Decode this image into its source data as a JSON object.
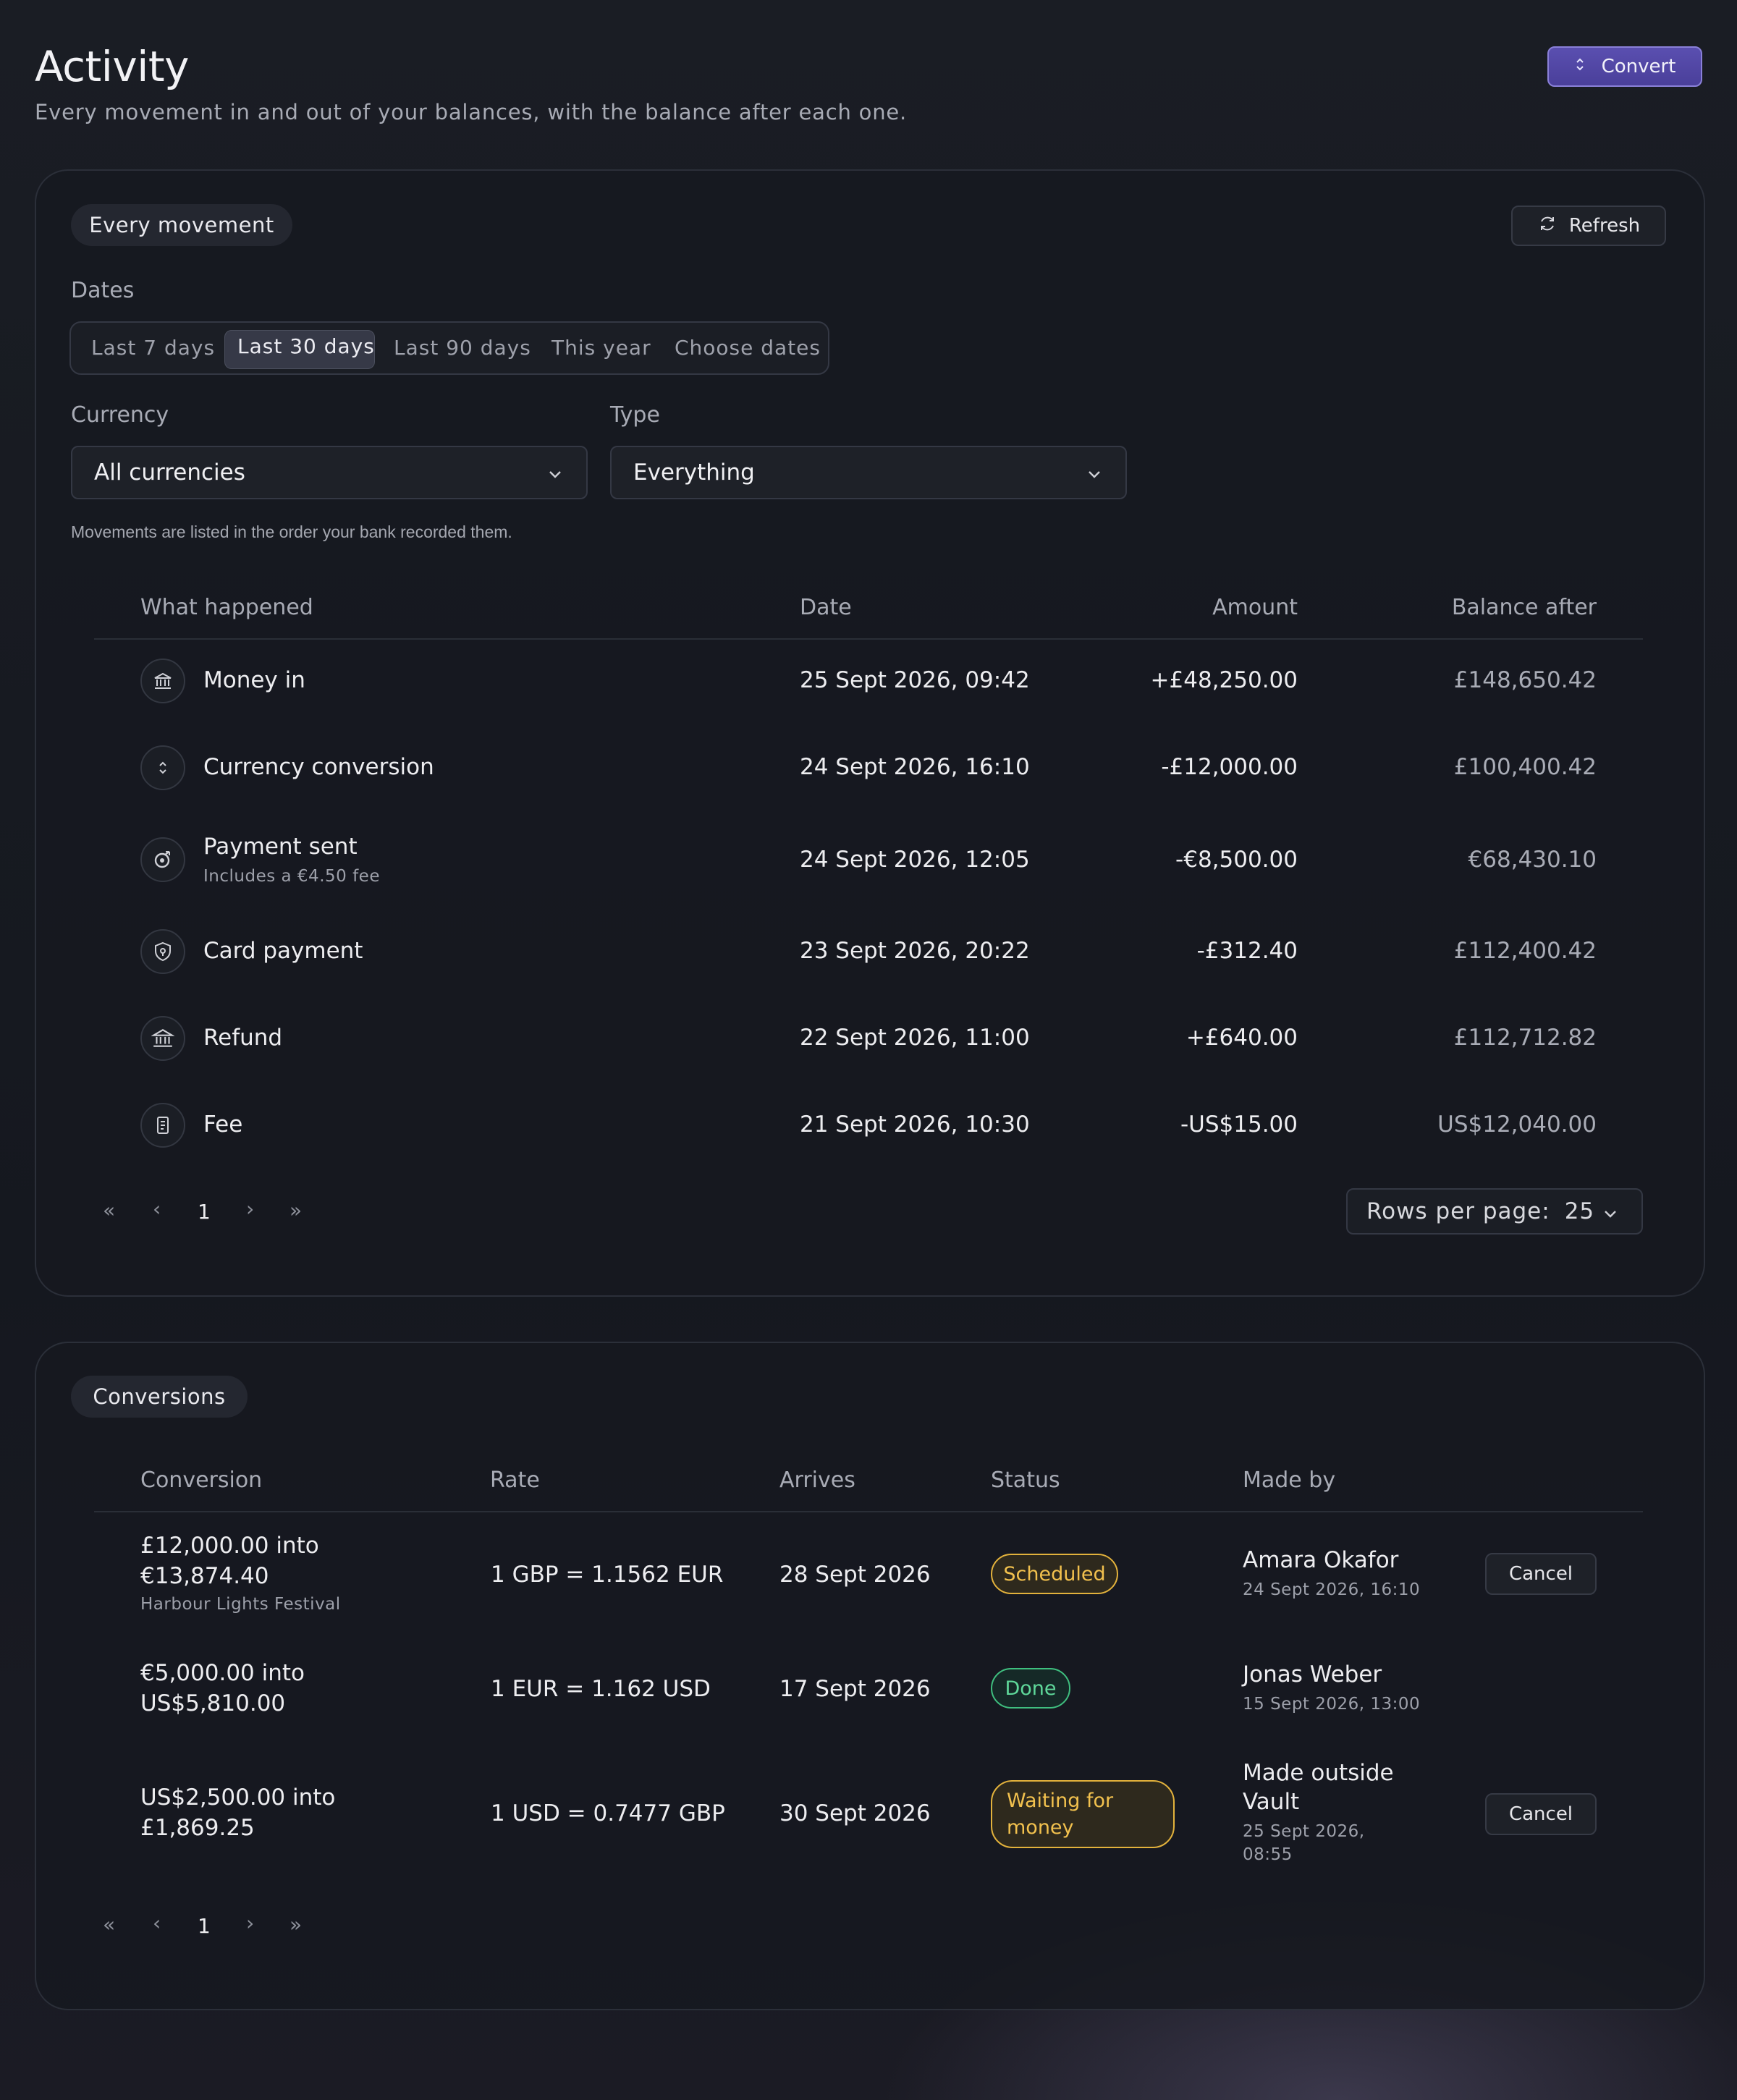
{
  "header": {
    "title": "Activity",
    "subtitle": "Every movement in and out of your balances, with the balance after each one.",
    "convert_label": "Convert"
  },
  "movements": {
    "title": "Every movement",
    "refresh_label": "Refresh",
    "dates_label": "Dates",
    "date_ranges": [
      "Last 7 days",
      "Last 30 days",
      "Last 90 days",
      "This year",
      "Choose dates"
    ],
    "selected_range": "Last 30 days",
    "currency_label": "Currency",
    "currency_value": "All currencies",
    "type_label": "Type",
    "type_value": "Everything",
    "note": "Movements are listed in the order your bank recorded them.",
    "columns": [
      "What happened",
      "Date",
      "Amount",
      "Balance after"
    ],
    "rows": [
      {
        "icon": "bank-icon",
        "what": "Money in",
        "detail": "",
        "date": "25 Sept 2026, 09:42",
        "amount": "+£48,250.00",
        "balance": "£148,650.42"
      },
      {
        "icon": "convert-icon",
        "what": "Currency conversion",
        "detail": "",
        "date": "24 Sept 2026, 16:10",
        "amount": "-£12,000.00",
        "balance": "£100,400.42"
      },
      {
        "icon": "send-icon",
        "what": "Payment sent",
        "detail": "Includes a €4.50 fee",
        "date": "24 Sept 2026, 12:05",
        "amount": "-€8,500.00",
        "balance": "€68,430.10"
      },
      {
        "icon": "card-shield-icon",
        "what": "Card payment",
        "detail": "",
        "date": "23 Sept 2026, 20:22",
        "amount": "-£312.40",
        "balance": "£112,400.42"
      },
      {
        "icon": "bank-icon",
        "what": "Refund",
        "detail": "",
        "date": "22 Sept 2026, 11:00",
        "amount": "+£640.00",
        "balance": "£112,712.82"
      },
      {
        "icon": "receipt-icon",
        "what": "Fee",
        "detail": "",
        "date": "21 Sept 2026, 10:30",
        "amount": "-US$15.00",
        "balance": "US$12,040.00"
      }
    ],
    "pager": {
      "first": "«",
      "prev": "‹",
      "page": "1",
      "next": "›",
      "last": "»"
    },
    "rows_per_page_label": "Rows per page:",
    "rows_per_page_value": "25"
  },
  "conversions": {
    "title": "Conversions",
    "columns": [
      "Conversion",
      "Rate",
      "Arrives",
      "Status",
      "Made by"
    ],
    "rows": [
      {
        "line1": "£12,000.00 into",
        "line2": "€13,874.40",
        "note": "Harbour Lights Festival",
        "rate": "1 GBP = 1.1562 EUR",
        "arrives": "28 Sept 2026",
        "status": "Scheduled",
        "by1": "Amara Okafor",
        "by2": "",
        "when1": "24 Sept 2026, 16:10",
        "when2": "",
        "action": "Cancel"
      },
      {
        "line1": "€5,000.00 into",
        "line2": "US$5,810.00",
        "note": "",
        "rate": "1 EUR = 1.162 USD",
        "arrives": "17 Sept 2026",
        "status": "Done",
        "by1": "Jonas Weber",
        "by2": "",
        "when1": "15 Sept 2026, 13:00",
        "when2": "",
        "action": ""
      },
      {
        "line1": "US$2,500.00 into",
        "line2": "£1,869.25",
        "note": "",
        "rate": "1 USD = 0.7477 GBP",
        "arrives": "30 Sept 2026",
        "status1": "Waiting for",
        "status2": "money",
        "by1": "Made outside",
        "by2": "Vault",
        "when1": "25 Sept 2026,",
        "when2": "08:55",
        "action": "Cancel"
      }
    ],
    "pager": {
      "first": "«",
      "prev": "‹",
      "page": "1",
      "next": "›",
      "last": "»"
    }
  },
  "colors": {
    "accent": "#5a4fb0",
    "scheduled": "#f2c14e",
    "done": "#5fd89a"
  }
}
